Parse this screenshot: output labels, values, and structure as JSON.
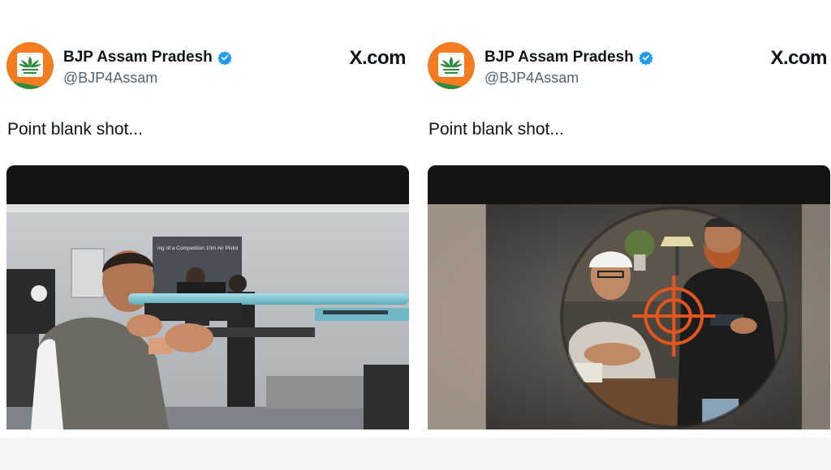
{
  "posts": [
    {
      "account_name": "BJP Assam Pradesh",
      "handle": "@BJP4Assam",
      "site": "X.com",
      "text": "Point blank shot...",
      "media_alt": "Man aiming an air rifle at a shooting range",
      "poster_text": "ing of a Competition 10m Air Pistol"
    },
    {
      "account_name": "BJP Assam Pradesh",
      "handle": "@BJP4Assam",
      "site": "X.com",
      "text": "Point blank shot...",
      "media_alt": "Illustration seen through a scope with crosshair over two men"
    }
  ],
  "colors": {
    "verified": "#1d9bf0",
    "avatar_orange": "#f47c20",
    "avatar_green": "#2e8b3e",
    "crosshair": "#e2551f"
  },
  "icons": [
    "bjp-lotus-logo-icon",
    "verified-badge-icon",
    "crosshair-icon"
  ]
}
